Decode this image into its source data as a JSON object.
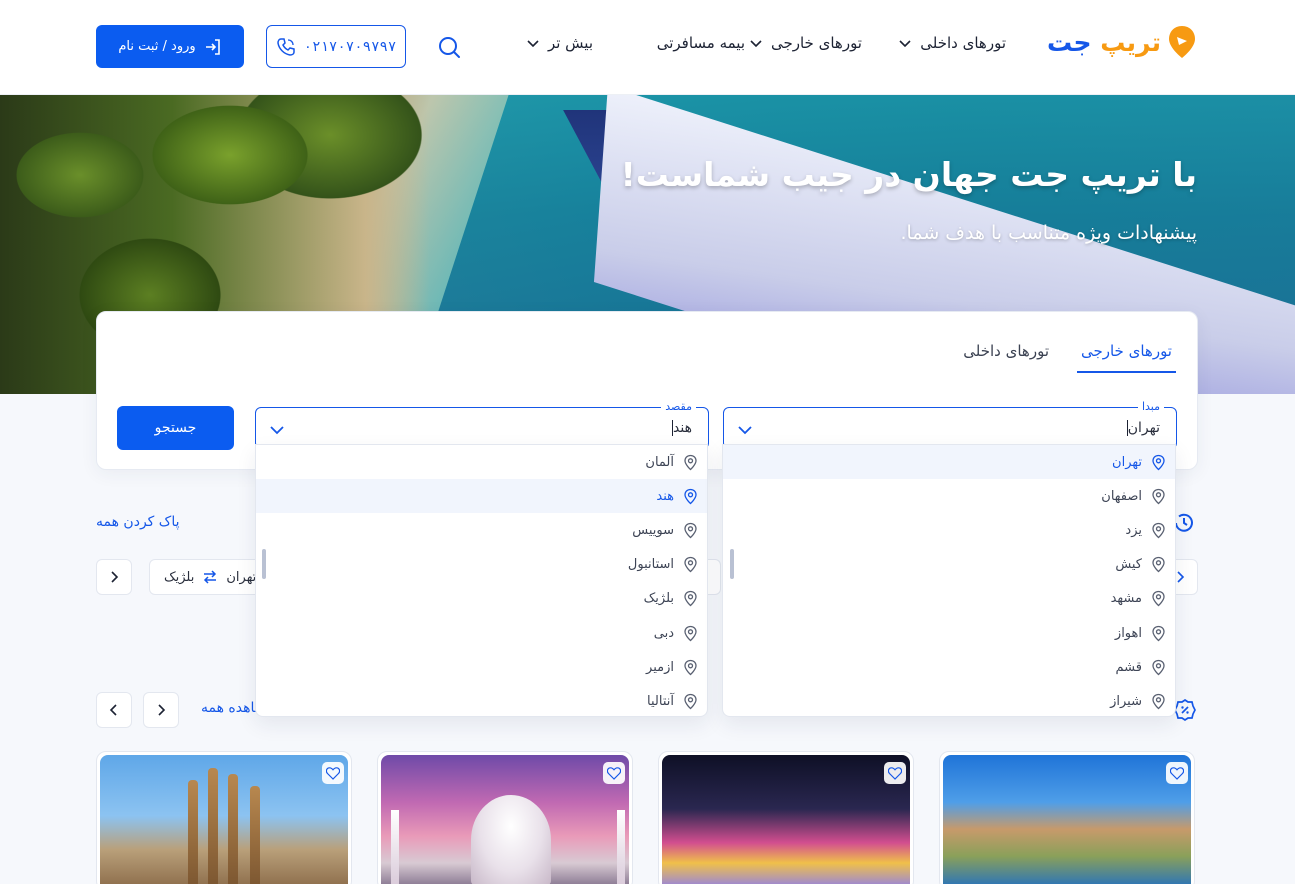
{
  "header": {
    "logo_main": "تریپ",
    "logo_accent": "جت",
    "nav": {
      "domestic": "تورهای داخلی",
      "foreign": "تورهای خارجی",
      "insurance": "بیمه مسافرتی",
      "more": "بیش تر"
    },
    "phone": "۰۲۱۷۰۷۰۹۷۹۷",
    "login": "ورود / ثبت نام"
  },
  "hero": {
    "title": "با تریپ جت جهان در جیب شماست!",
    "subtitle": "پیشنهادات ویژه متناسب با هدف شما."
  },
  "search": {
    "tabs": {
      "foreign": "تورهای خارجی",
      "domestic": "تورهای داخلی"
    },
    "origin_label": "مبدا",
    "origin_value": "تهران",
    "dest_label": "مقصد",
    "dest_value": "هند",
    "submit": "جستجو"
  },
  "origin_options": [
    "تهران",
    "اصفهان",
    "یزد",
    "کیش",
    "مشهد",
    "اهواز",
    "قشم",
    "شیراز"
  ],
  "dest_options": [
    "آلمان",
    "هند",
    "سوییس",
    "استانبول",
    "بلژیک",
    "دبی",
    "ازمیر",
    "آنتالیا"
  ],
  "recent": {
    "clear_all": "پاک کردن همه",
    "chip_from": "تهران",
    "chip_to": "بلژیک"
  },
  "offers": {
    "see_all": "مشاهده همه"
  },
  "colors": {
    "primary": "#0b5cf0",
    "accent_orange": "#f79a12"
  }
}
